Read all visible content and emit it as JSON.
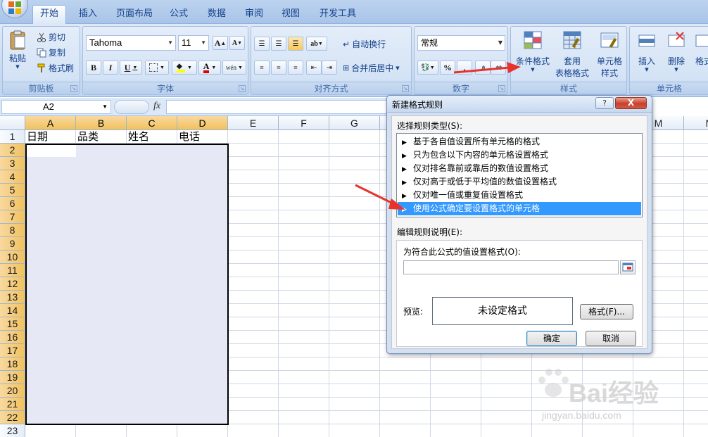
{
  "ribbon_tabs": [
    "开始",
    "插入",
    "页面布局",
    "公式",
    "数据",
    "审阅",
    "视图",
    "开发工具"
  ],
  "clipboard": {
    "paste": "粘贴",
    "cut": "剪切",
    "copy": "复制",
    "format_painter": "格式刷",
    "title": "剪贴板"
  },
  "font": {
    "name": "Tahoma",
    "size": "11",
    "bold": "B",
    "italic": "I",
    "underline": "U",
    "grow": "A",
    "shrink": "A",
    "font_color_letter": "A",
    "phonetic": "wén",
    "title": "字体"
  },
  "alignment": {
    "wrap": "自动换行",
    "merge": "合并后居中",
    "title": "对齐方式"
  },
  "number": {
    "format": "常规",
    "percent": "%",
    "comma": ",",
    "title": "数字"
  },
  "styles": {
    "conditional": "条件格式",
    "table_line1": "套用",
    "table_line2": "表格格式",
    "cell_line1": "单元格",
    "cell_line2": "样式",
    "title": "样式"
  },
  "cells": {
    "insert": "插入",
    "delete": "删除",
    "format": "格式",
    "title": "单元格"
  },
  "formula_bar": {
    "name_box": "A2",
    "fx": "fx"
  },
  "columns": [
    "A",
    "B",
    "C",
    "D",
    "E",
    "F",
    "G",
    "H",
    "I",
    "J",
    "K",
    "L",
    "M",
    "N"
  ],
  "rows": [
    "1",
    "2",
    "3",
    "4",
    "5",
    "6",
    "7",
    "8",
    "9",
    "10",
    "11",
    "12",
    "13",
    "14",
    "15",
    "16",
    "17",
    "18",
    "19",
    "20",
    "21",
    "22",
    "23"
  ],
  "headers": {
    "a1": "日期",
    "b1": "品类",
    "c1": "姓名",
    "d1": "电话"
  },
  "dialog": {
    "title": "新建格式规则",
    "help": "?",
    "close": "X",
    "select_type_label": "选择规则类型(S):",
    "rules": [
      "基于各自值设置所有单元格的格式",
      "只为包含以下内容的单元格设置格式",
      "仅对排名靠前或靠后的数值设置格式",
      "仅对高于或低于平均值的数值设置格式",
      "仅对唯一值或重复值设置格式",
      "使用公式确定要设置格式的单元格"
    ],
    "selected_rule_index": 5,
    "edit_desc_label": "编辑规则说明(E):",
    "formula_label": "为符合此公式的值设置格式(O):",
    "formula_value": "",
    "preview_label": "预览:",
    "preview_text": "未设定格式",
    "format_button": "格式(F)...",
    "ok": "确定",
    "cancel": "取消"
  },
  "watermark": {
    "text": "Bai经验",
    "url": "jingyan.baidu.com"
  },
  "colors": {
    "accent": "#3399ff",
    "selection": "#e6e8f5",
    "arrow": "#e8322c",
    "ribbon": "#c6d9f0"
  }
}
